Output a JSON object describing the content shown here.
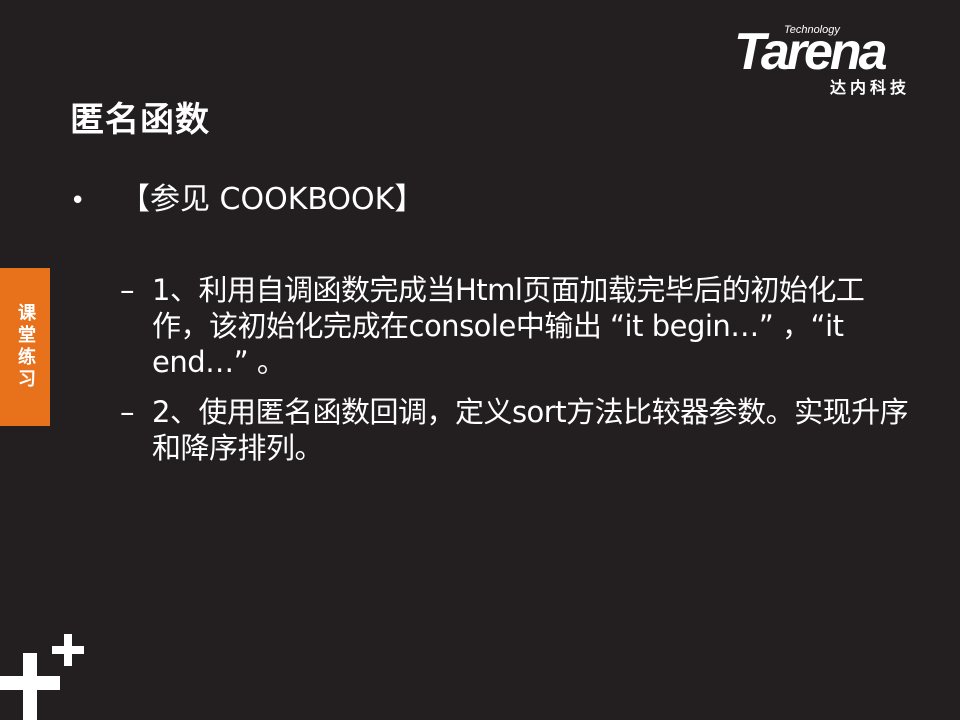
{
  "logo": {
    "tech": "Technology",
    "word": "Tarena",
    "cn": "达内科技"
  },
  "title": "匿名函数",
  "side_tab": "课堂练习",
  "bullet": {
    "dot": "•",
    "text": "【参见 COOKBOOK】"
  },
  "sub_items": [
    {
      "dash": "–",
      "text": "1、利用自调函数完成当Html页面加载完毕后的初始化工作，该初始化完成在console中输出 “it begin…” ，“it end…” 。"
    },
    {
      "dash": "–",
      "text": "2、使用匿名函数回调，定义sort方法比较器参数。实现升序和降序排列。"
    }
  ],
  "colors": {
    "background": "#231f20",
    "accent": "#e8711c",
    "text": "#ffffff"
  },
  "icons": {
    "decoration": "plus-icon"
  }
}
